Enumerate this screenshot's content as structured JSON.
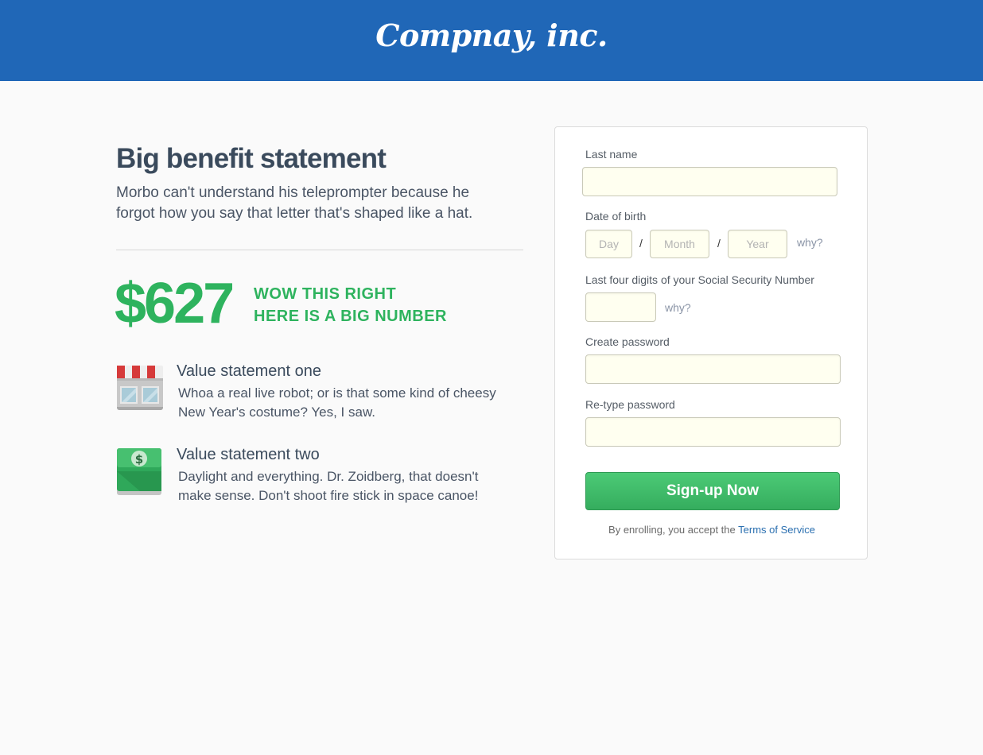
{
  "header": {
    "logo_text": "Compnay, inc."
  },
  "hero": {
    "headline": "Big benefit statement",
    "subhead": "Morbo can't understand his teleprompter because he forgot how you say that letter that's shaped like a hat."
  },
  "big_number": {
    "value": "$627",
    "caption_line1": "WOW THIS RIGHT",
    "caption_line2": "HERE IS A BIG NUMBER"
  },
  "value_statements": [
    {
      "icon": "storefront-icon",
      "title": "Value statement one",
      "body": "Whoa a real live robot; or is that some kind of cheesy New Year's costume? Yes, I saw."
    },
    {
      "icon": "money-icon",
      "title": "Value statement two",
      "body": "Daylight and everything. Dr. Zoidberg, that doesn't make sense. Don't shoot fire stick in space canoe!"
    }
  ],
  "form": {
    "last_name_label": "Last name",
    "last_name_value": "",
    "dob_label": "Date of birth",
    "day_placeholder": "Day",
    "month_placeholder": "Month",
    "year_placeholder": "Year",
    "dob_separator": "/",
    "why_label": "why?",
    "ssn_label": "Last four digits of your Social Security Number",
    "ssn_value": "",
    "password_label": "Create password",
    "retype_label": "Re-type password",
    "submit_label": "Sign-up Now",
    "terms_prefix": "By enrolling, you accept the ",
    "terms_link": "Terms of Service"
  },
  "colors": {
    "header_bg": "#2067b7",
    "accent_green": "#2eb35e",
    "input_bg": "#fffff0",
    "link": "#2a6fb0"
  }
}
